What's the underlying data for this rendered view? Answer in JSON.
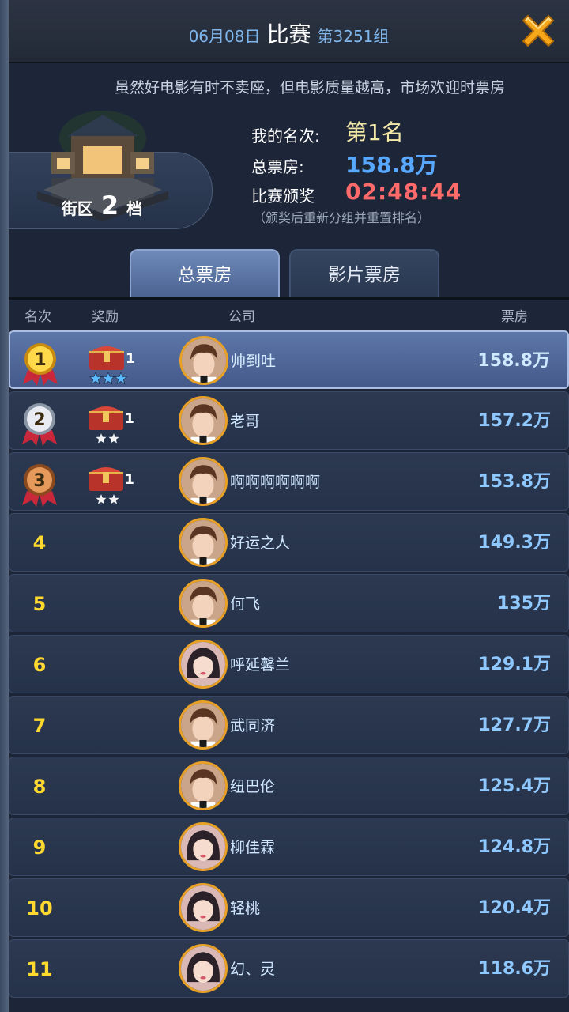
{
  "header": {
    "date": "06月08日",
    "title": "比赛",
    "group": "第3251组"
  },
  "marquee": "虽然好电影有时不卖座，但电影质量越高，市场欢迎时票房",
  "district": {
    "prefix": "街区",
    "level": "2",
    "suffix": "档"
  },
  "stats": {
    "my_rank_label": "我的名次:",
    "my_rank_value": "第1名",
    "total_box_label": "总票房:",
    "total_box_value": "158.8万",
    "award_label": "比赛颁奖",
    "award_timer": "02:48:44",
    "note": "（颁奖后重新分组并重置排名）"
  },
  "tabs": [
    {
      "label": "总票房",
      "active": true
    },
    {
      "label": "影片票房",
      "active": false
    }
  ],
  "columns": {
    "rank": "名次",
    "reward": "奖励",
    "company": "公司",
    "box": "票房"
  },
  "rows": [
    {
      "rank": "1",
      "company": "帅到吐",
      "box": "158.8万",
      "reward_count": "1",
      "stars": 3,
      "avatar": "male"
    },
    {
      "rank": "2",
      "company": "老哥",
      "box": "157.2万",
      "reward_count": "1",
      "stars": 2,
      "avatar": "male"
    },
    {
      "rank": "3",
      "company": "啊啊啊啊啊啊",
      "box": "153.8万",
      "reward_count": "1",
      "stars": 2,
      "avatar": "male"
    },
    {
      "rank": "4",
      "company": "好运之人",
      "box": "149.3万",
      "avatar": "male"
    },
    {
      "rank": "5",
      "company": "何飞",
      "box": "135万",
      "avatar": "male"
    },
    {
      "rank": "6",
      "company": "呼延馨兰",
      "box": "129.1万",
      "avatar": "female"
    },
    {
      "rank": "7",
      "company": "武同济",
      "box": "127.7万",
      "avatar": "male"
    },
    {
      "rank": "8",
      "company": "纽巴伦",
      "box": "125.4万",
      "avatar": "male"
    },
    {
      "rank": "9",
      "company": "柳佳霖",
      "box": "124.8万",
      "avatar": "female"
    },
    {
      "rank": "10",
      "company": "轻桃",
      "box": "120.4万",
      "avatar": "female"
    },
    {
      "rank": "11",
      "company": "幻、灵",
      "box": "118.6万",
      "avatar": "female"
    }
  ],
  "colors": {
    "accent": "#58a8ff",
    "timer": "#ff6a6a",
    "gold": "#ffd92e",
    "close": "#f6a81a"
  }
}
